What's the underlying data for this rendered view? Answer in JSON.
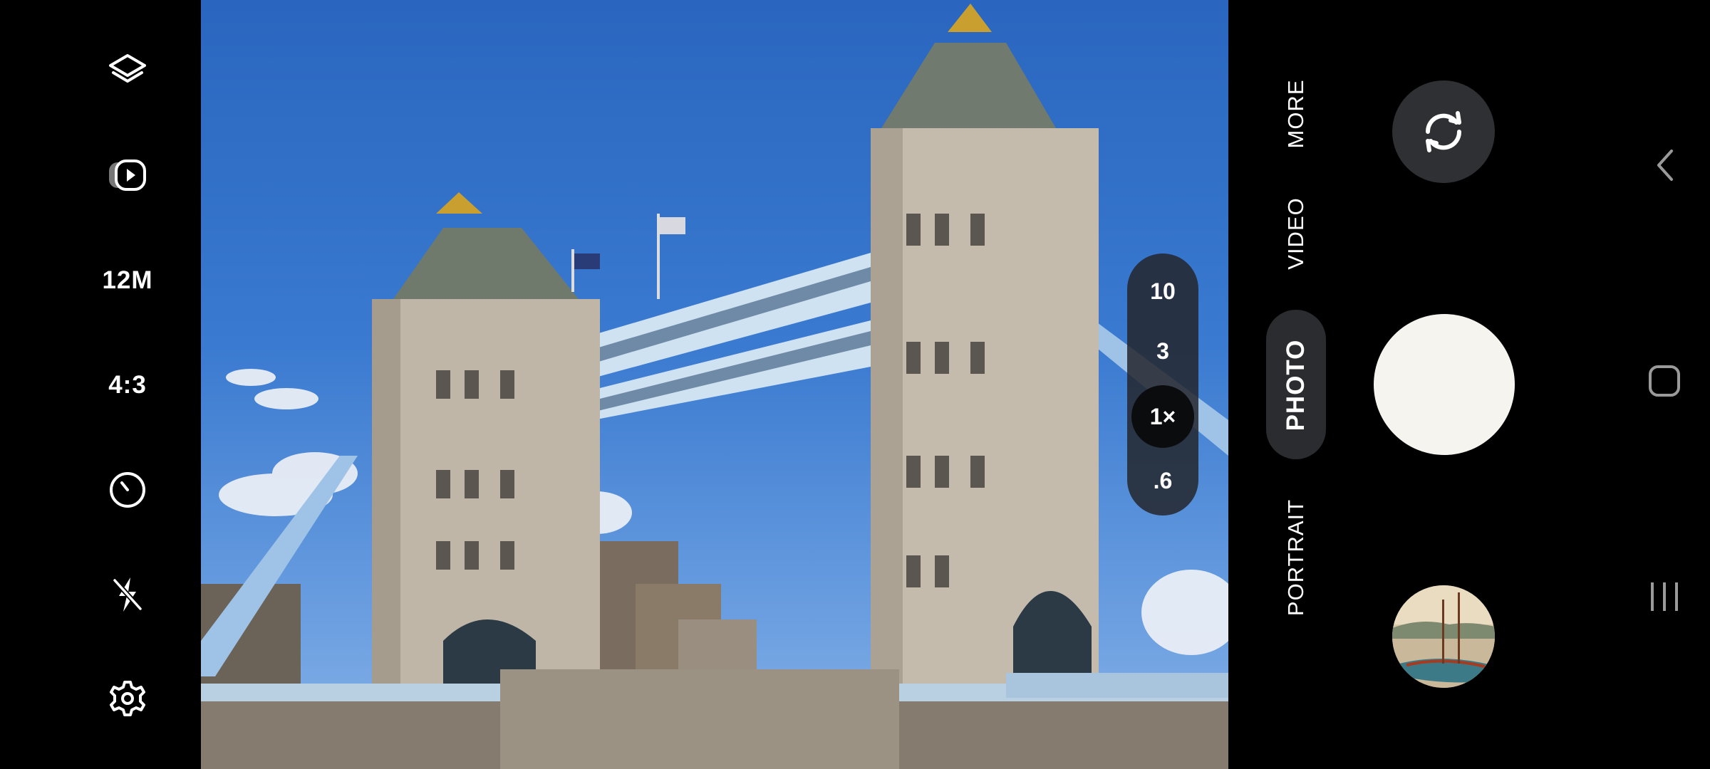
{
  "left_rail": {
    "resolution_label": "12M",
    "ratio_label": "4:3",
    "icons": [
      "filters-icon",
      "motion-photo-icon",
      "timer-icon",
      "flash-off-icon",
      "settings-icon"
    ]
  },
  "zoom": {
    "options": [
      "10",
      "3",
      "1×",
      ".6"
    ],
    "selected": "1×"
  },
  "modes": {
    "items": [
      "MORE",
      "VIDEO",
      "PHOTO",
      "PORTRAIT"
    ],
    "selected": "PHOTO"
  },
  "controls": {
    "switch_camera_icon": "switch-camera-icon",
    "shutter": "shutter-button",
    "gallery": "gallery-thumbnail"
  },
  "nav": {
    "icons": [
      "back-icon",
      "home-icon",
      "recents-icon"
    ]
  },
  "colors": {
    "accent": "#ffffff",
    "pill_bg": "#23262c",
    "shutter": "#f6f4ef"
  }
}
